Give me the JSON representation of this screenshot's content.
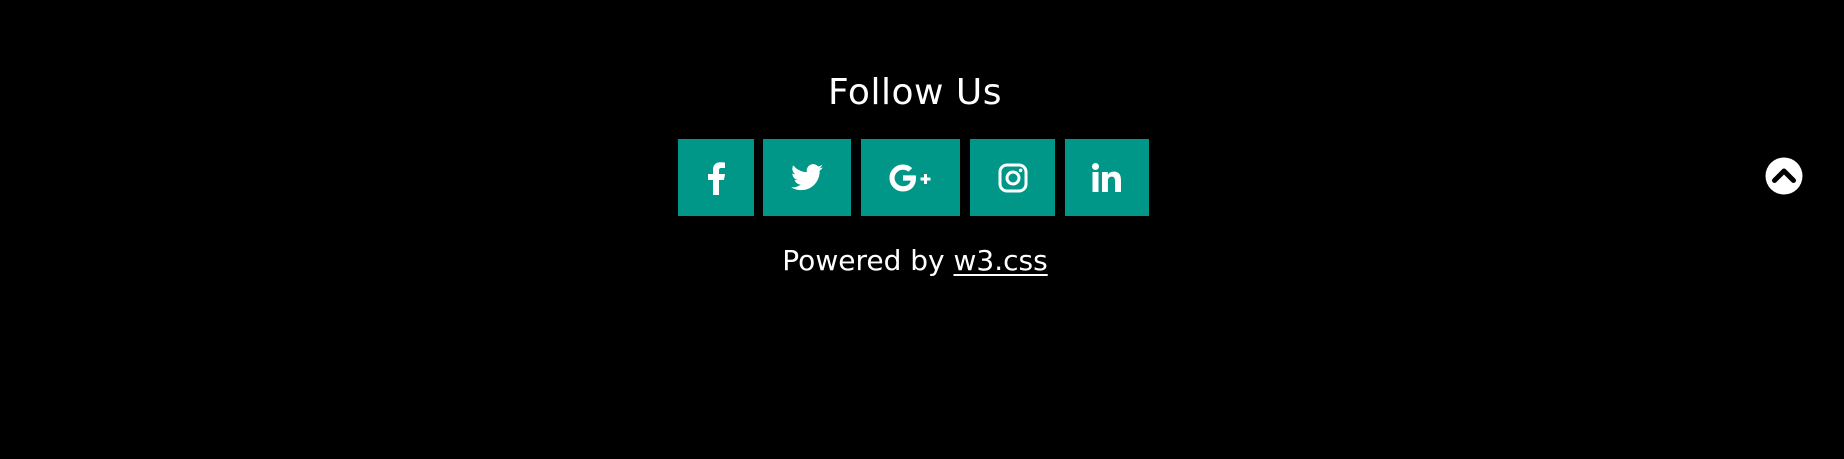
{
  "colors": {
    "background": "#000000",
    "accent": "#009688",
    "text": "#ffffff"
  },
  "footer": {
    "title": "Follow Us",
    "social": [
      {
        "name": "facebook",
        "icon": "facebook-icon"
      },
      {
        "name": "twitter",
        "icon": "twitter-icon"
      },
      {
        "name": "google-plus",
        "icon": "google-plus-icon"
      },
      {
        "name": "instagram",
        "icon": "instagram-icon"
      },
      {
        "name": "linkedin",
        "icon": "linkedin-icon"
      }
    ],
    "powered_prefix": "Powered by",
    "powered_link": "w3.css",
    "to_top_icon": "chevron-up-circle-icon"
  }
}
